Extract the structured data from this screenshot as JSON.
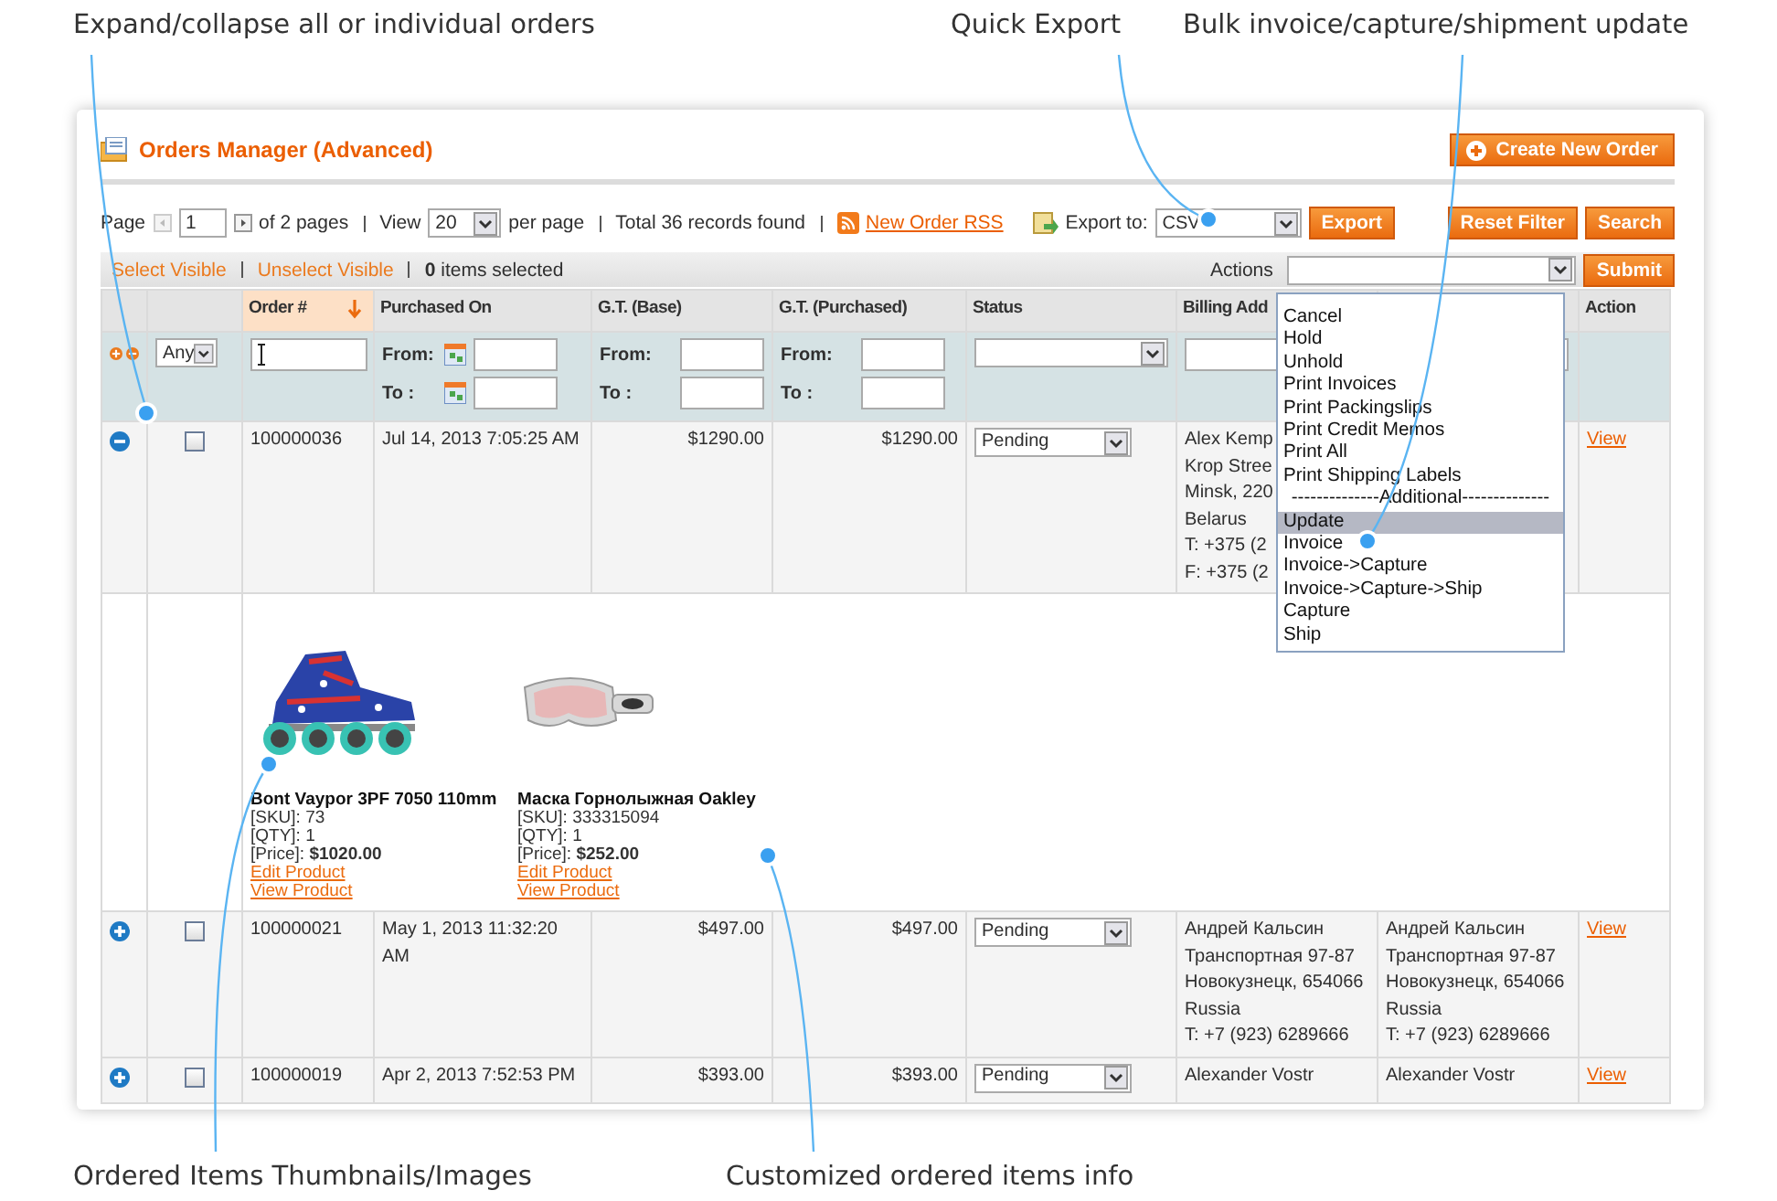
{
  "annotations": [
    {
      "text": "Expand/collapse all or individual orders",
      "kind": "top"
    },
    {
      "text": "Quick Export",
      "kind": "top"
    },
    {
      "text": "Bulk invoice/capture/shipment update",
      "kind": "top"
    },
    {
      "text": "Ordered Items Thumbnails/Images",
      "kind": "bottom"
    },
    {
      "text": "Customized ordered items info",
      "kind": "bottom"
    }
  ],
  "panel": {
    "title": "Orders Manager (Advanced)",
    "create_button": "Create New Order"
  },
  "pager": {
    "page_label": "Page",
    "page": "1",
    "of_pages": "of 2 pages",
    "view_label": "View",
    "per_page": "20",
    "per_page_label": "per page",
    "total": "Total 36 records found",
    "rss_link": "New Order RSS",
    "export_label": "Export to:",
    "export_format": "CSV",
    "export_button": "Export",
    "reset_button": "Reset Filter",
    "search_button": "Search"
  },
  "massaction": {
    "select_visible": "Select Visible",
    "unselect_visible": "Unselect Visible",
    "selected_text": "**0** items selected",
    "actions_label": "Actions",
    "submit_button": "Submit",
    "options": [
      {
        "label": "Cancel",
        "kind": "option",
        "selected": false
      },
      {
        "label": "Hold",
        "kind": "option",
        "selected": false
      },
      {
        "label": "Unhold",
        "kind": "option",
        "selected": false
      },
      {
        "label": "Print Invoices",
        "kind": "option",
        "selected": false
      },
      {
        "label": "Print Packingslips",
        "kind": "option",
        "selected": false
      },
      {
        "label": "Print Credit Memos",
        "kind": "option",
        "selected": false
      },
      {
        "label": "Print All",
        "kind": "option",
        "selected": false
      },
      {
        "label": "Print Shipping Labels",
        "kind": "option",
        "selected": false
      },
      {
        "label": "--------------Additional--------------",
        "kind": "separator",
        "selected": false
      },
      {
        "label": "Update",
        "kind": "option",
        "selected": true
      },
      {
        "label": "Invoice",
        "kind": "option",
        "selected": false
      },
      {
        "label": "Invoice->Capture",
        "kind": "option",
        "selected": false
      },
      {
        "label": "Invoice->Capture->Ship",
        "kind": "option",
        "selected": false
      },
      {
        "label": "Capture",
        "kind": "option",
        "selected": false
      },
      {
        "label": "Ship",
        "kind": "option",
        "selected": false
      }
    ]
  },
  "columns": [
    {
      "label": "Order #",
      "sorted": true
    },
    {
      "label": "Purchased On",
      "sorted": false
    },
    {
      "label": "G.T. (Base)",
      "sorted": false
    },
    {
      "label": "G.T. (Purchased)",
      "sorted": false
    },
    {
      "label": "Status",
      "sorted": false
    },
    {
      "label": "Billing Add",
      "sorted": false
    },
    {
      "label": "Action",
      "sorted": false
    }
  ],
  "filters": {
    "checkbox_filter": "Any",
    "purchased_from": "From:",
    "purchased_to": "To :",
    "base_from": "From:",
    "base_to": "To :",
    "gt_from": "From:",
    "gt_to": "To :"
  },
  "orders": [
    {
      "number": "100000036",
      "purchased_on": "Jul 14, 2013 7:05:25 AM",
      "gt_base": "$1290.00",
      "gt_purchased": "$1290.00",
      "status": "Pending",
      "billing": [
        "Alex Kemp",
        "Krop Stree",
        "Minsk, 220",
        "Belarus",
        "T: +375 (2",
        "F: +375 (2"
      ],
      "action": "View",
      "expanded": true,
      "checked": false,
      "items": [
        {
          "kind": "skate",
          "name": "Bont Vaypor 3PF 7050 110mm",
          "sku": "[SKU]: 73",
          "qty": "[QTY]: 1",
          "price": "[Price]: **$1020.00**",
          "edit_link": "Edit Product",
          "view_link": "View Product"
        },
        {
          "kind": "goggles",
          "name": "Маска Горнолыжная Oakley",
          "sku": "[SKU]: 333315094",
          "qty": "[QTY]: 1",
          "price": "[Price]: **$252.00**",
          "edit_link": "Edit Product",
          "view_link": "View Product"
        }
      ]
    },
    {
      "number": "100000021",
      "purchased_on": "May 1, 2013 11:32:20 AM",
      "gt_base": "$497.00",
      "gt_purchased": "$497.00",
      "status": "Pending",
      "billing": [
        "Андрей Кальсин",
        "Транспортная 97-87",
        "Новокузнецк, 654066",
        "Russia",
        "T: +7 (923) 6289666"
      ],
      "shipping": [
        "Андрей Кальсин",
        "Транспортная 97-87",
        "Новокузнецк, 654066",
        "Russia",
        "T: +7 (923) 6289666"
      ],
      "action": "View",
      "expanded": false,
      "checked": false
    },
    {
      "number": "100000019",
      "purchased_on": "Apr 2, 2013 7:52:53 PM",
      "gt_base": "$393.00",
      "gt_purchased": "$393.00",
      "status": "Pending",
      "billing": [
        "Alexander Vostr"
      ],
      "shipping": [
        "Alexander Vostr"
      ],
      "action": "View",
      "expanded": false,
      "checked": false
    }
  ]
}
